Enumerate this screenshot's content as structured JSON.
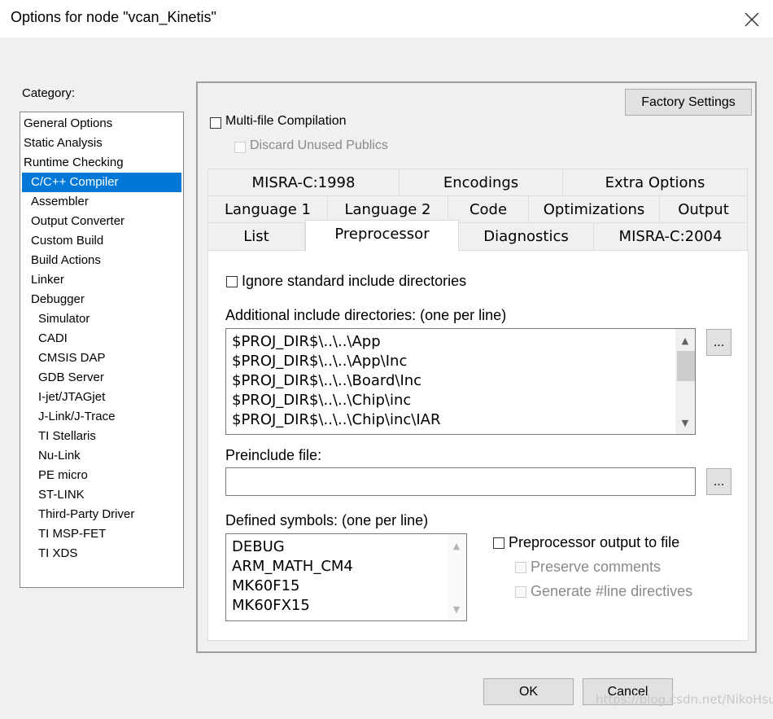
{
  "window": {
    "title": "Options for node \"vcan_Kinetis\""
  },
  "category": {
    "label": "Category:",
    "items": [
      "General Options",
      "Static Analysis",
      "Runtime Checking",
      "C/C++ Compiler",
      "Assembler",
      "Output Converter",
      "Custom Build",
      "Build Actions",
      "Linker",
      "Debugger",
      "Simulator",
      "CADI",
      "CMSIS DAP",
      "GDB Server",
      "I-jet/JTAGjet",
      "J-Link/J-Trace",
      "TI Stellaris",
      "Nu-Link",
      "PE micro",
      "ST-LINK",
      "Third-Party Driver",
      "TI MSP-FET",
      "TI XDS"
    ],
    "selected": "C/C++ Compiler"
  },
  "panel": {
    "factory_settings": "Factory Settings",
    "multi_file": "Multi-file Compilation",
    "discard_unused": "Discard Unused Publics",
    "tabs_row1": [
      "MISRA-C:1998",
      "Encodings",
      "Extra Options"
    ],
    "tabs_row2": [
      "Language 1",
      "Language 2",
      "Code",
      "Optimizations",
      "Output"
    ],
    "tabs_row3": [
      "List",
      "Preprocessor",
      "Diagnostics",
      "MISRA-C:2004"
    ],
    "active_tab": "Preprocessor"
  },
  "preprocessor": {
    "ignore_std": "Ignore standard include directories",
    "additional_label": "Additional include directories: (one per line)",
    "include_dirs": [
      "$PROJ_DIR$\\..\\..\\App",
      "$PROJ_DIR$\\..\\..\\App\\Inc",
      "$PROJ_DIR$\\..\\..\\Board\\Inc",
      "$PROJ_DIR$\\..\\..\\Chip\\inc",
      "$PROJ_DIR$\\..\\..\\Chip\\inc\\IAR"
    ],
    "browse_label": "...",
    "preinclude_label": "Preinclude file:",
    "preinclude_value": "",
    "defined_label": "Defined symbols: (one per line)",
    "defined_symbols": [
      "DEBUG",
      "ARM_MATH_CM4",
      "MK60F15",
      "MK60FX15"
    ],
    "pp_output": "Preprocessor output to file",
    "preserve_comments": "Preserve comments",
    "generate_line": "Generate #line directives"
  },
  "footer": {
    "ok": "OK",
    "cancel": "Cancel",
    "watermark": "https://blog.csdn.net/NikoHsu"
  }
}
